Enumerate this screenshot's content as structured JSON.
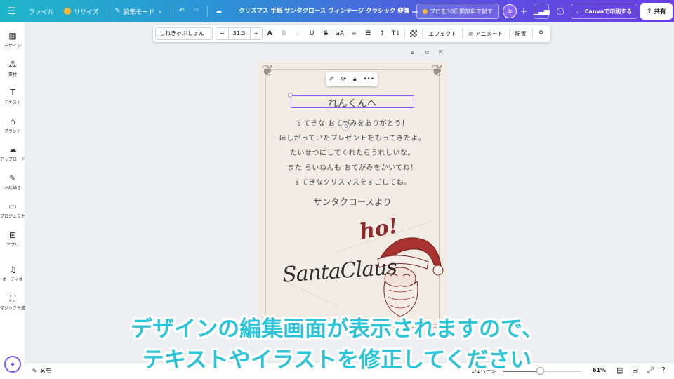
{
  "topbar": {
    "menu_icon": "hamburger-icon",
    "file_label": "ファイル",
    "resize_label": "リサイズ",
    "edit_mode_label": "編集モード",
    "doc_title": "クリスマス 手紙 サンタクロース ヴィンテージ クラシック 便箋 ...",
    "pro_trial_label": "プロを30日間無料で試す",
    "avatar_letter": "キ",
    "print_label": "Canvaで印刷する",
    "share_label": "共有",
    "gradient_colors": [
      "#1fb6c9",
      "#2e8fd6",
      "#5b4fe0",
      "#6a3fe3"
    ]
  },
  "sidebar": {
    "items": [
      {
        "label": "デザイン",
        "icon": "layout-icon",
        "glyph": "▦"
      },
      {
        "label": "素材",
        "icon": "elements-icon",
        "glyph": "⁂"
      },
      {
        "label": "テキスト",
        "icon": "text-icon",
        "glyph": "T"
      },
      {
        "label": "ブランド",
        "icon": "brand-icon",
        "glyph": "⌂"
      },
      {
        "label": "アップロード",
        "icon": "cloud-upload-icon",
        "glyph": "☁"
      },
      {
        "label": "お絵描き",
        "icon": "pen-icon",
        "glyph": "✎"
      },
      {
        "label": "プロジェクト",
        "icon": "folder-icon",
        "glyph": "▭"
      },
      {
        "label": "アプリ",
        "icon": "apps-icon",
        "glyph": "⊞"
      },
      {
        "label": "オーディオ",
        "icon": "music-icon",
        "glyph": "♫"
      },
      {
        "label": "マジック生成",
        "icon": "magic-image-icon",
        "glyph": "⛶"
      }
    ]
  },
  "format_toolbar": {
    "font_name": "しねきゃぷしょん",
    "size_minus": "−",
    "font_size": "31.3",
    "size_plus": "+",
    "effect_label": "エフェクト",
    "animate_label": "アニメート",
    "position_label": "配置"
  },
  "letter": {
    "heading": "れんくんへ",
    "lines": [
      "すてきな おてがみをありがとう！",
      "ほしがっていたプレゼントをもってきたよ。",
      "たいせつにしてくれたらうれしいな。",
      "また らいねんも おてがみをかいてね！",
      "すてきなクリスマスをすごしてね。"
    ],
    "signature": "サンタクロースより",
    "ho_text": "ho!",
    "script_name": "SantaClaus"
  },
  "bottombar": {
    "memo_label": "メモ",
    "pages_label": "1/1ページ",
    "zoom_label": "61%",
    "zoom_fraction": 0.47
  },
  "caption": {
    "line1": "デザインの編集画面が表示されますので、",
    "line2": "テキストやイラストを修正してください"
  }
}
